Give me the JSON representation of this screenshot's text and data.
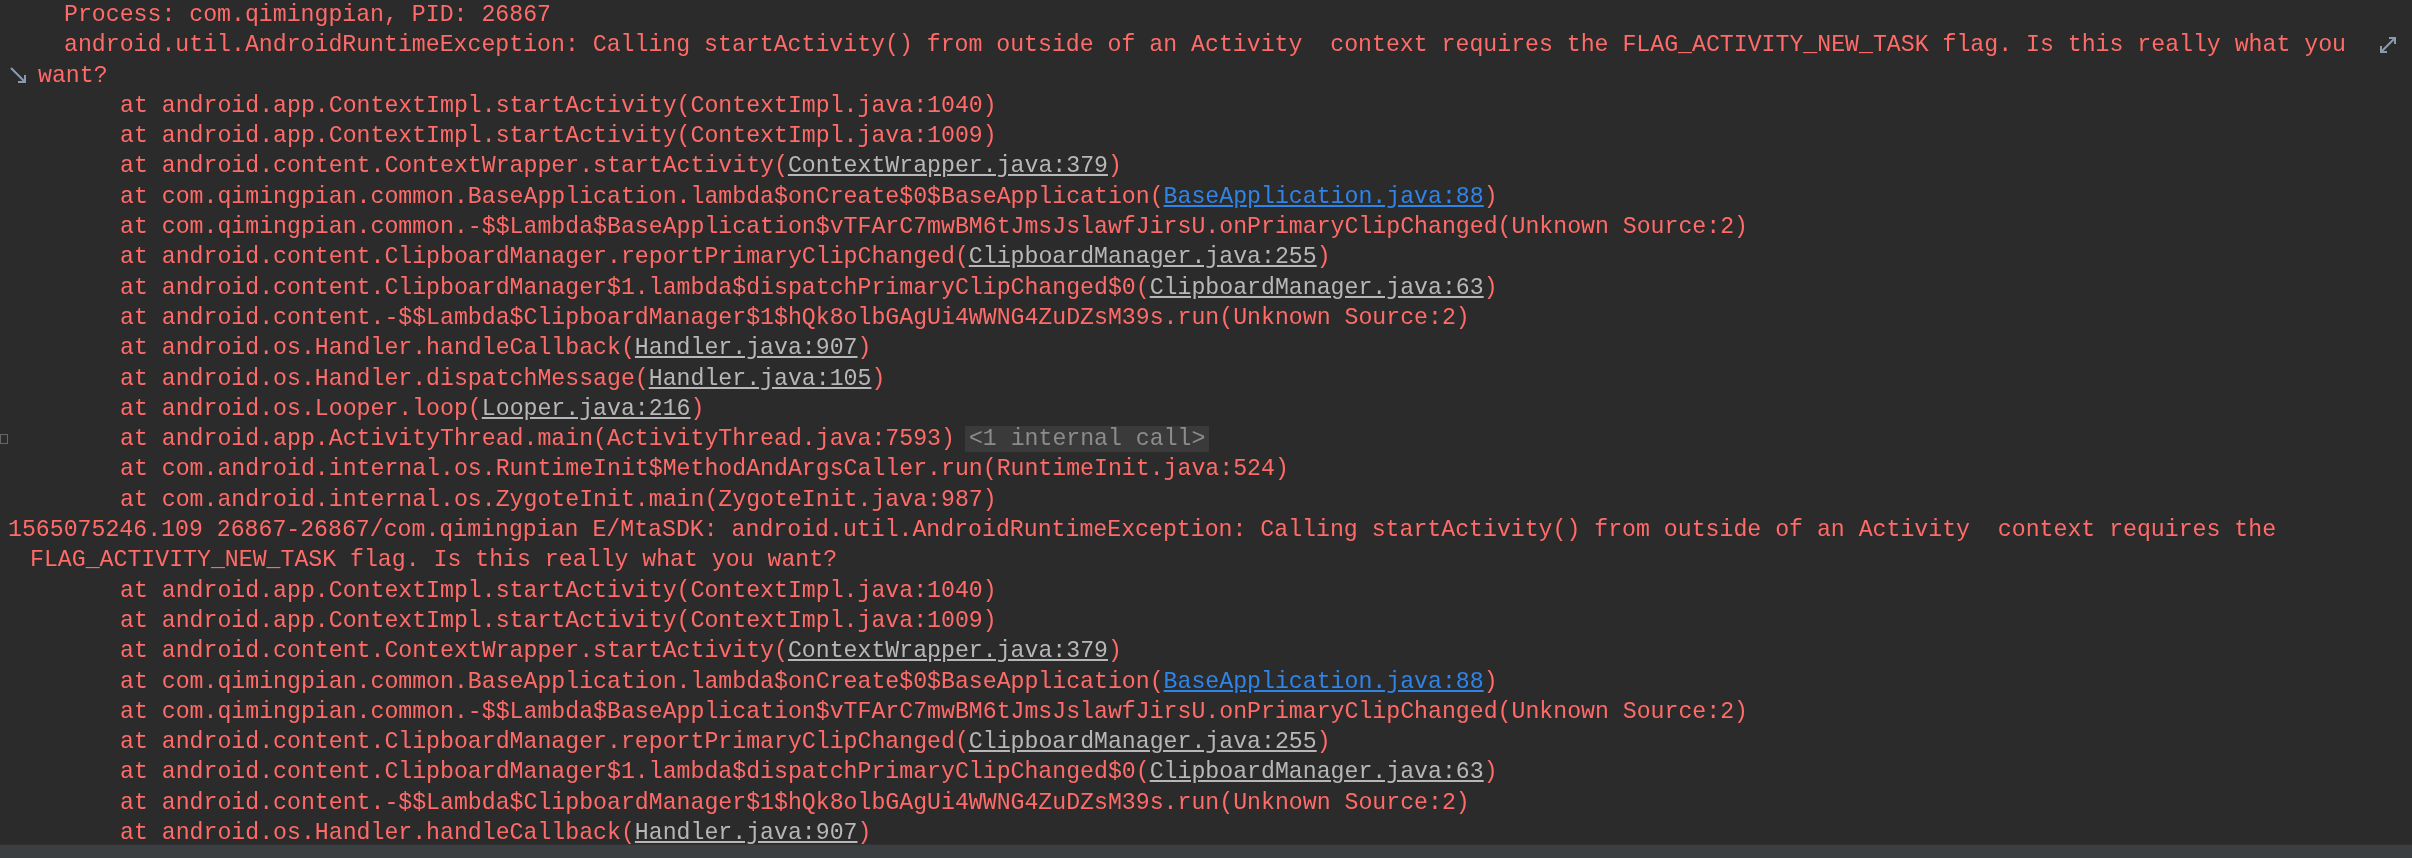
{
  "log": [
    {
      "kind": "info",
      "text": "Process: com.qimingpian, PID: 26867"
    },
    {
      "kind": "message",
      "lines": [
        "android.util.AndroidRuntimeException: Calling startActivity() from outside of an Activity  context requires the FLAG_ACTIVITY_NEW_TASK flag. Is this really what you",
        "want?"
      ],
      "wrap_marks": true
    },
    {
      "kind": "frame",
      "prefix": "at android.app.ContextImpl.startActivity(ContextImpl.java:1040)"
    },
    {
      "kind": "frame",
      "prefix": "at android.app.ContextImpl.startActivity(ContextImpl.java:1009)"
    },
    {
      "kind": "frame",
      "prefix": "at android.content.ContextWrapper.startActivity(",
      "source": "ContextWrapper.java:379",
      "project": false,
      "suffix": ")"
    },
    {
      "kind": "frame",
      "prefix": "at com.qimingpian.common.BaseApplication.lambda$onCreate$0$BaseApplication(",
      "source": "BaseApplication.java:88",
      "project": true,
      "suffix": ")"
    },
    {
      "kind": "frame",
      "prefix": "at com.qimingpian.common.-$$Lambda$BaseApplication$vTFArC7mwBM6tJmsJslawfJirsU.onPrimaryClipChanged(Unknown Source:2)"
    },
    {
      "kind": "frame",
      "prefix": "at android.content.ClipboardManager.reportPrimaryClipChanged(",
      "source": "ClipboardManager.java:255",
      "project": false,
      "suffix": ")"
    },
    {
      "kind": "frame",
      "prefix": "at android.content.ClipboardManager$1.lambda$dispatchPrimaryClipChanged$0(",
      "source": "ClipboardManager.java:63",
      "project": false,
      "suffix": ")"
    },
    {
      "kind": "frame",
      "prefix": "at android.content.-$$Lambda$ClipboardManager$1$hQk8olbGAgUi4WWNG4ZuDZsM39s.run(Unknown Source:2)"
    },
    {
      "kind": "frame",
      "prefix": "at android.os.Handler.handleCallback(",
      "source": "Handler.java:907",
      "project": false,
      "suffix": ")"
    },
    {
      "kind": "frame",
      "prefix": "at android.os.Handler.dispatchMessage(",
      "source": "Handler.java:105",
      "project": false,
      "suffix": ")"
    },
    {
      "kind": "frame",
      "prefix": "at android.os.Looper.loop(",
      "source": "Looper.java:216",
      "project": false,
      "suffix": ")"
    },
    {
      "kind": "frame",
      "prefix": "at android.app.ActivityThread.main(ActivityThread.java:7593)",
      "note": "<1 internal call>",
      "folded": true
    },
    {
      "kind": "frame",
      "prefix": "at com.android.internal.os.RuntimeInit$MethodAndArgsCaller.run(RuntimeInit.java:524)"
    },
    {
      "kind": "frame",
      "prefix": "at com.android.internal.os.ZygoteInit.main(ZygoteInit.java:987)"
    },
    {
      "kind": "entry",
      "lines": [
        "1565075246.109 26867-26867/com.qimingpian E/MtaSDK: android.util.AndroidRuntimeException: Calling startActivity() from outside of an Activity  context requires the",
        "FLAG_ACTIVITY_NEW_TASK flag. Is this really what you want?"
      ]
    },
    {
      "kind": "frame",
      "prefix": "at android.app.ContextImpl.startActivity(ContextImpl.java:1040)"
    },
    {
      "kind": "frame",
      "prefix": "at android.app.ContextImpl.startActivity(ContextImpl.java:1009)"
    },
    {
      "kind": "frame",
      "prefix": "at android.content.ContextWrapper.startActivity(",
      "source": "ContextWrapper.java:379",
      "project": false,
      "suffix": ")"
    },
    {
      "kind": "frame",
      "prefix": "at com.qimingpian.common.BaseApplication.lambda$onCreate$0$BaseApplication(",
      "source": "BaseApplication.java:88",
      "project": true,
      "suffix": ")"
    },
    {
      "kind": "frame",
      "prefix": "at com.qimingpian.common.-$$Lambda$BaseApplication$vTFArC7mwBM6tJmsJslawfJirsU.onPrimaryClipChanged(Unknown Source:2)"
    },
    {
      "kind": "frame",
      "prefix": "at android.content.ClipboardManager.reportPrimaryClipChanged(",
      "source": "ClipboardManager.java:255",
      "project": false,
      "suffix": ")"
    },
    {
      "kind": "frame",
      "prefix": "at android.content.ClipboardManager$1.lambda$dispatchPrimaryClipChanged$0(",
      "source": "ClipboardManager.java:63",
      "project": false,
      "suffix": ")"
    },
    {
      "kind": "frame",
      "prefix": "at android.content.-$$Lambda$ClipboardManager$1$hQk8olbGAgUi4WWNG4ZuDZsM39s.run(Unknown Source:2)"
    },
    {
      "kind": "frame",
      "prefix": "at android.os.Handler.handleCallback(",
      "source": "Handler.java:907",
      "project": false,
      "suffix": ")"
    }
  ]
}
